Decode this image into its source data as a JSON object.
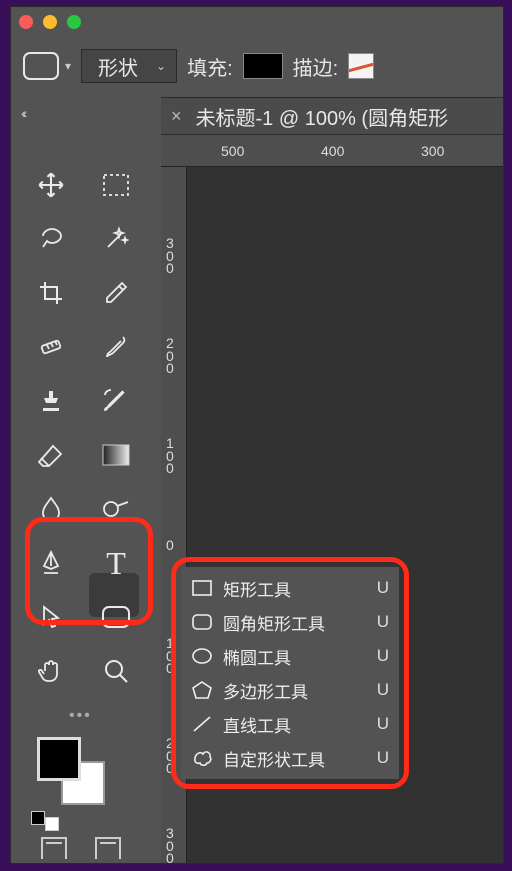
{
  "window": {
    "title": "未标题-1 @ 100% (圆角矩形"
  },
  "optbar": {
    "mode_label": "形状",
    "fill_label": "填充:",
    "stroke_label": "描边:"
  },
  "ruler_h": [
    "500",
    "400",
    "300"
  ],
  "ruler_v": [
    "0",
    "300",
    "200",
    "100",
    "0",
    "300"
  ],
  "tools": [
    {
      "n": "move-tool"
    },
    {
      "n": "marquee-tool"
    },
    {
      "n": "lasso-tool"
    },
    {
      "n": "magic-wand-tool"
    },
    {
      "n": "crop-tool"
    },
    {
      "n": "eyedropper-tool"
    },
    {
      "n": "healing-brush-tool"
    },
    {
      "n": "brush-tool"
    },
    {
      "n": "clone-stamp-tool"
    },
    {
      "n": "history-brush-tool"
    },
    {
      "n": "eraser-tool"
    },
    {
      "n": "gradient-tool"
    },
    {
      "n": "blur-tool"
    },
    {
      "n": "dodge-tool"
    },
    {
      "n": "pen-tool"
    },
    {
      "n": "type-tool"
    },
    {
      "n": "path-selection-tool"
    },
    {
      "n": "rounded-rectangle-tool"
    },
    {
      "n": "hand-tool"
    },
    {
      "n": "zoom-tool"
    }
  ],
  "flyout": [
    {
      "icon": "rect",
      "label": "矩形工具",
      "key": "U"
    },
    {
      "icon": "rrect",
      "label": "圆角矩形工具",
      "key": "U"
    },
    {
      "icon": "ellipse",
      "label": "椭圆工具",
      "key": "U"
    },
    {
      "icon": "poly",
      "label": "多边形工具",
      "key": "U"
    },
    {
      "icon": "line",
      "label": "直线工具",
      "key": "U"
    },
    {
      "icon": "custom",
      "label": "自定形状工具",
      "key": "U"
    }
  ]
}
